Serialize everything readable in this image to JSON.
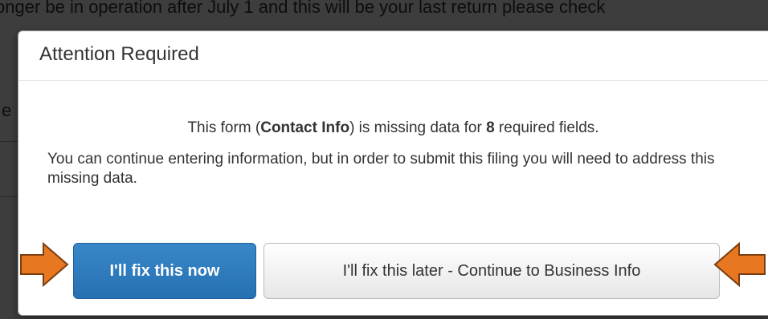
{
  "background": {
    "top_text": "onger be in operation after July 1 and this will be your last return please check",
    "left_text": "e",
    "bottom_text": ""
  },
  "modal": {
    "title": "Attention Required",
    "missing_message": {
      "prefix": "This form (",
      "form_name": "Contact Info",
      "middle": ") is missing data for ",
      "count": "8",
      "suffix": " required fields."
    },
    "continue_message": "You can continue entering information, but in order to submit this filing you will need to address this missing data.",
    "buttons": {
      "fix_now": "I'll fix this now",
      "fix_later": "I'll fix this later - Continue to Business Info"
    }
  },
  "annotations": {
    "arrow_color": "#e87722",
    "arrow_outline": "#7a3e10",
    "left_arrow_icon": "arrow-right-icon",
    "right_arrow_icon": "arrow-left-icon"
  },
  "colors": {
    "primary_button": "#2a78bb",
    "overlay": "rgba(0,0,0,0.5)"
  }
}
